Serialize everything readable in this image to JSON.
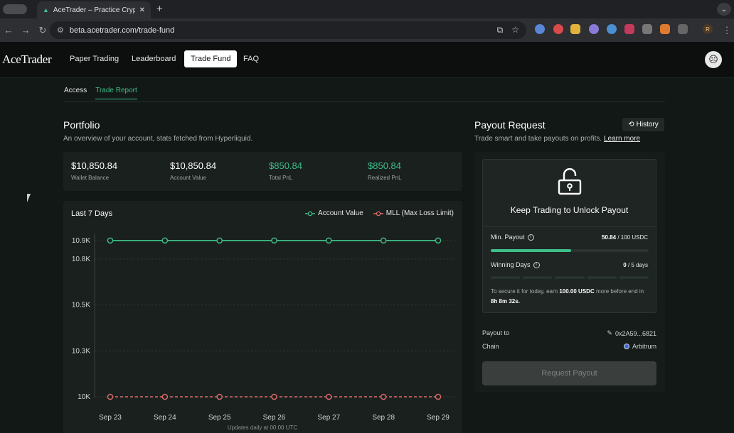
{
  "browser": {
    "tab_title": "AceTrader – Practice Crypto T",
    "url": "beta.acetrader.com/trade-fund",
    "profile_initial": "R"
  },
  "nav": {
    "logo": "AceTrader",
    "links": [
      "Paper Trading",
      "Leaderboard",
      "Trade Fund",
      "FAQ"
    ],
    "active_link": "Trade Fund"
  },
  "subtabs": {
    "access": "Access",
    "trade_report": "Trade Report"
  },
  "portfolio": {
    "title": "Portfolio",
    "subtitle": "An overview of your account, stats fetched from Hyperliquid.",
    "stats": [
      {
        "value": "$10,850.84",
        "label": "Wallet Balance"
      },
      {
        "value": "$10,850.84",
        "label": "Account Value"
      },
      {
        "value": "$850.84",
        "label": "Total PnL"
      },
      {
        "value": "$850.84",
        "label": "Realized PnL"
      }
    ]
  },
  "chart_data": {
    "type": "line",
    "title": "Last 7 Days",
    "categories": [
      "Sep 23",
      "Sep 24",
      "Sep 25",
      "Sep 26",
      "Sep 27",
      "Sep 28",
      "Sep 29"
    ],
    "series": [
      {
        "name": "Account Value",
        "values": [
          10850.84,
          10850.84,
          10850.84,
          10850.84,
          10850.84,
          10850.84,
          10850.84
        ],
        "color": "#3fbf8a"
      },
      {
        "name": "MLL (Max Loss Limit)",
        "values": [
          10000,
          10000,
          10000,
          10000,
          10000,
          10000,
          10000
        ],
        "color": "#e06c6c"
      }
    ],
    "yticks": [
      {
        "value": 10850,
        "label": "10.9K"
      },
      {
        "value": 10750,
        "label": "10.8K"
      },
      {
        "value": 10500,
        "label": "10.5K"
      },
      {
        "value": 10250,
        "label": "10.3K"
      },
      {
        "value": 10000,
        "label": "10K"
      }
    ],
    "ylim": [
      10000,
      10850
    ],
    "footnote": "Updates daily at 00:00 UTC",
    "legend_placement": "top-right",
    "grid": true
  },
  "payout": {
    "title": "Payout Request",
    "subtitle": "Trade smart and take payouts on profits.",
    "learn_more": "Learn more",
    "history_label": "History",
    "unlock_title": "Keep Trading to Unlock Payout",
    "min_payout_label": "Min. Payout",
    "min_payout_current": "50.84",
    "min_payout_target": "/ 100 USDC",
    "min_payout_progress": 0.5084,
    "winning_days_label": "Winning Days",
    "winning_days_current": "0",
    "winning_days_target": "/ 5 days",
    "winning_days_segments": 5,
    "secure_note_pre": "To secure it for today, earn",
    "secure_note_amount": "100.00 USDC",
    "secure_note_mid": "more before end in",
    "secure_note_time": "8h 8m 32s",
    "payout_to_label": "Payout to",
    "payout_to_value": "0x2A59...6821",
    "chain_label": "Chain",
    "chain_value": "Arbitrum",
    "request_button": "Request Payout"
  },
  "colors": {
    "accent": "#3fbf8a",
    "danger": "#e06c6c"
  }
}
